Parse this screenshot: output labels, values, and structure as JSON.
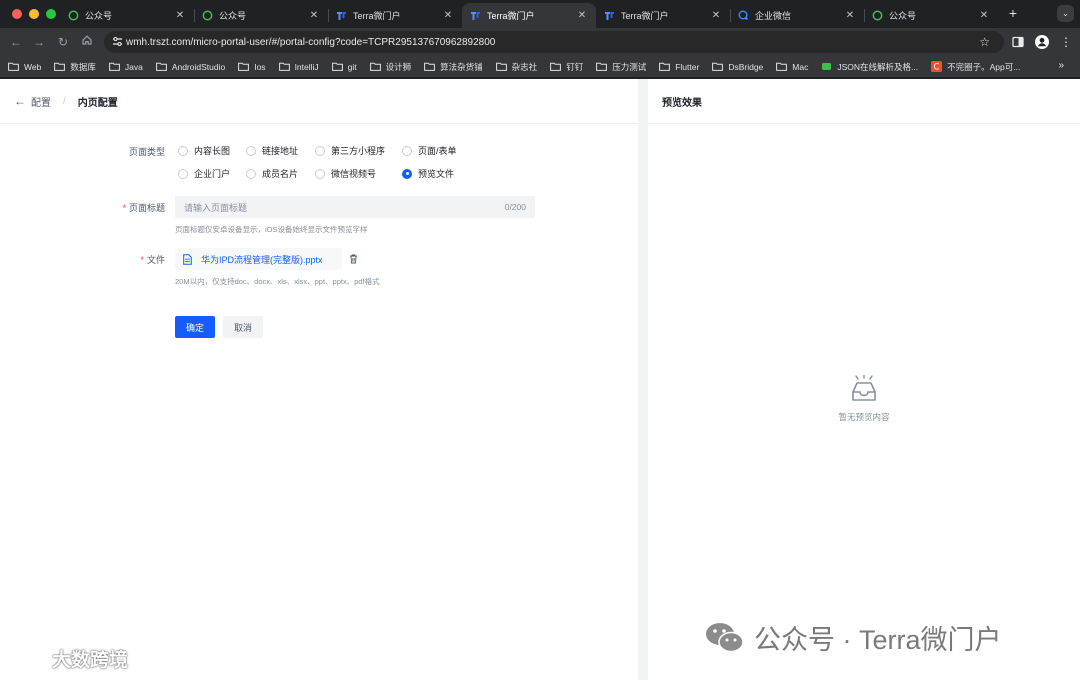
{
  "browser": {
    "tabs": [
      {
        "title": "公众号",
        "icon": "wechat-official-icon",
        "active": false
      },
      {
        "title": "公众号",
        "icon": "wechat-official-icon",
        "active": false
      },
      {
        "title": "Terra微门户",
        "icon": "terra-icon",
        "active": false
      },
      {
        "title": "Terra微门户",
        "icon": "terra-icon",
        "active": true
      },
      {
        "title": "Terra微门户",
        "icon": "terra-icon",
        "active": false
      },
      {
        "title": "企业微信",
        "icon": "wecom-icon",
        "active": false
      },
      {
        "title": "公众号",
        "icon": "wechat-official-icon",
        "active": false
      }
    ],
    "new_tab": "+",
    "url": "wmh.trszt.com/micro-portal-user/#/portal-config?code=TCPR295137670962892800",
    "bookmarks": [
      "Web",
      "数据库",
      "Java",
      "AndroidStudio",
      "Ios",
      "IntelliJ",
      "git",
      "设计狮",
      "算法杂货铺",
      "杂志社",
      "钉钉",
      "压力测试",
      "Flutter",
      "DsBridge",
      "Mac",
      "JSON在线解析及格...",
      "不完圈子。App可..."
    ],
    "bookmarks_more": "»"
  },
  "breadcrumb": {
    "back": "配置",
    "separator": "/",
    "current": "内页配置"
  },
  "form": {
    "page_type": {
      "label": "页面类型",
      "options": [
        "内容长图",
        "链接地址",
        "第三方小程序",
        "页面/表单",
        "企业门户",
        "成员名片",
        "微信视频号",
        "预览文件"
      ],
      "selected": "预览文件"
    },
    "page_title": {
      "label": "页面标题",
      "required": "*",
      "placeholder": "请输入页面标题",
      "counter": "0/200",
      "hint": "页面标题仅安卓设备显示，iOS设备始终显示文件预览字样"
    },
    "file": {
      "label": "文件",
      "required": "*",
      "name": "华为IPD流程管理(完整版).pptx",
      "hint": "20M以内，仅支持doc、docx、xls、xlsx、ppt、pptx、pdf格式"
    },
    "confirm": "确定",
    "cancel": "取消"
  },
  "preview": {
    "title": "预览效果",
    "empty_text": "暂无预览内容"
  },
  "watermarks": {
    "right": "公众号 · Terra微门户",
    "left": "大数跨境"
  },
  "colors": {
    "primary": "#165dff",
    "required": "#f53f3f",
    "chrome_dark": "#202124",
    "chrome_toolbar": "#35363a"
  }
}
